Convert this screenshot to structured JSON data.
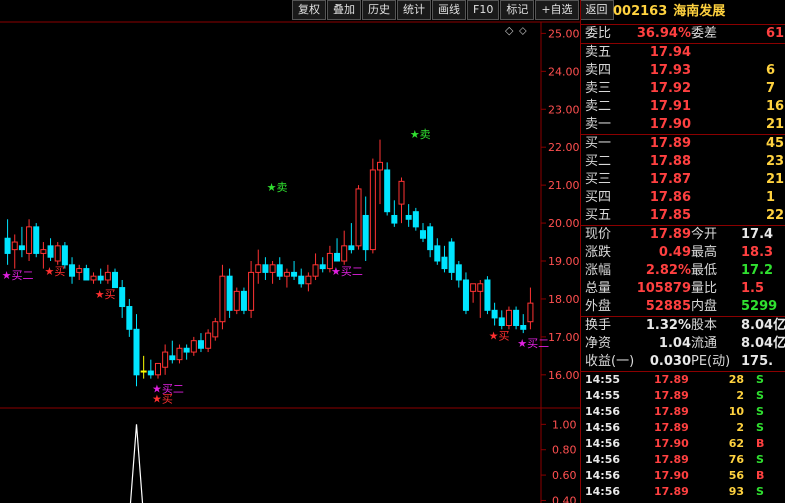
{
  "toolbar": [
    "复权",
    "叠加",
    "历史",
    "统计",
    "画线",
    "F10",
    "标记",
    "+自选",
    "返回"
  ],
  "header_icons": [
    "◇",
    "⬦"
  ],
  "stock": {
    "code": "002163",
    "name": "海南发展"
  },
  "entrust": {
    "ratio_label": "委比",
    "ratio": "36.94%",
    "diff_label": "委差",
    "diff": "61"
  },
  "asks": [
    {
      "label": "卖五",
      "price": "17.94",
      "vol": ""
    },
    {
      "label": "卖四",
      "price": "17.93",
      "vol": "6"
    },
    {
      "label": "卖三",
      "price": "17.92",
      "vol": "7"
    },
    {
      "label": "卖二",
      "price": "17.91",
      "vol": "16"
    },
    {
      "label": "卖一",
      "price": "17.90",
      "vol": "21"
    }
  ],
  "bids": [
    {
      "label": "买一",
      "price": "17.89",
      "vol": "45"
    },
    {
      "label": "买二",
      "price": "17.88",
      "vol": "23"
    },
    {
      "label": "买三",
      "price": "17.87",
      "vol": "21"
    },
    {
      "label": "买四",
      "price": "17.86",
      "vol": "1"
    },
    {
      "label": "买五",
      "price": "17.85",
      "vol": "22"
    }
  ],
  "quote": [
    {
      "l1": "现价",
      "v1": "17.89",
      "c1": "red",
      "l2": "今开",
      "v2": "17.4",
      "c2": "white"
    },
    {
      "l1": "涨跌",
      "v1": "0.49",
      "c1": "red",
      "l2": "最高",
      "v2": "18.3",
      "c2": "red"
    },
    {
      "l1": "涨幅",
      "v1": "2.82%",
      "c1": "red",
      "l2": "最低",
      "v2": "17.2",
      "c2": "green"
    },
    {
      "l1": "总量",
      "v1": "105879",
      "c1": "red",
      "l2": "量比",
      "v2": "1.5",
      "c2": "red"
    },
    {
      "l1": "外盘",
      "v1": "52885",
      "c1": "red",
      "l2": "内盘",
      "v2": "5299",
      "c2": "green"
    }
  ],
  "stats": [
    {
      "l1": "换手",
      "v1": "1.32%",
      "l2": "股本",
      "v2": "8.04亿"
    },
    {
      "l1": "净资",
      "v1": "1.04",
      "l2": "流通",
      "v2": "8.04亿"
    },
    {
      "l1": "收益(一)",
      "v1": "0.030",
      "l2": "PE(动)",
      "v2": "175."
    }
  ],
  "ticks": [
    {
      "time": "14:55",
      "price": "17.89",
      "vol": "28",
      "side": "S"
    },
    {
      "time": "14:55",
      "price": "17.89",
      "vol": "2",
      "side": "S"
    },
    {
      "time": "14:56",
      "price": "17.89",
      "vol": "10",
      "side": "S"
    },
    {
      "time": "14:56",
      "price": "17.89",
      "vol": "2",
      "side": "S"
    },
    {
      "time": "14:56",
      "price": "17.90",
      "vol": "62",
      "side": "B"
    },
    {
      "time": "14:56",
      "price": "17.89",
      "vol": "76",
      "side": "S"
    },
    {
      "time": "14:56",
      "price": "17.90",
      "vol": "56",
      "side": "B"
    },
    {
      "time": "14:56",
      "price": "17.89",
      "vol": "93",
      "side": "S"
    }
  ],
  "colors": {
    "up": "#ff3333",
    "down": "#00e5ff",
    "flat": "#ffff00",
    "buy_sig": "#ff3030",
    "buy2_sig": "#e020e0",
    "sell_sig": "#30e030",
    "axis": "#8b0000"
  },
  "chart_data": {
    "type": "candlestick",
    "price_axis": {
      "ticks": [
        "25.00",
        "24.00",
        "23.00",
        "22.00",
        "21.00",
        "20.00",
        "19.00",
        "18.00",
        "17.00",
        "16.00"
      ],
      "min": 15.6,
      "max": 25.3
    },
    "indicator_axis": {
      "ticks": [
        "1.00",
        "0.80",
        "0.60",
        "0.40"
      ],
      "min": 0.38,
      "max": 1.05
    },
    "candles": [
      {
        "o": 19.6,
        "h": 20.1,
        "l": 18.9,
        "c": 19.2
      },
      {
        "o": 19.3,
        "h": 19.7,
        "l": 18.8,
        "c": 19.5
      },
      {
        "o": 19.4,
        "h": 19.9,
        "l": 19.1,
        "c": 19.3
      },
      {
        "o": 19.2,
        "h": 20.1,
        "l": 19.0,
        "c": 19.9
      },
      {
        "o": 19.9,
        "h": 20.0,
        "l": 19.1,
        "c": 19.2
      },
      {
        "o": 19.2,
        "h": 19.5,
        "l": 18.8,
        "c": 19.3
      },
      {
        "o": 19.4,
        "h": 19.6,
        "l": 19.0,
        "c": 19.1
      },
      {
        "o": 19.0,
        "h": 19.5,
        "l": 18.9,
        "c": 19.4
      },
      {
        "o": 19.4,
        "h": 19.5,
        "l": 18.8,
        "c": 18.9
      },
      {
        "o": 18.9,
        "h": 19.1,
        "l": 18.4,
        "c": 18.6
      },
      {
        "o": 18.7,
        "h": 18.9,
        "l": 18.5,
        "c": 18.8
      },
      {
        "o": 18.8,
        "h": 18.9,
        "l": 18.5,
        "c": 18.5
      },
      {
        "o": 18.5,
        "h": 18.7,
        "l": 18.4,
        "c": 18.6
      },
      {
        "o": 18.6,
        "h": 18.8,
        "l": 18.4,
        "c": 18.5
      },
      {
        "o": 18.5,
        "h": 18.9,
        "l": 18.4,
        "c": 18.7
      },
      {
        "o": 18.7,
        "h": 18.8,
        "l": 18.3,
        "c": 18.3
      },
      {
        "o": 18.3,
        "h": 18.5,
        "l": 17.5,
        "c": 17.8
      },
      {
        "o": 17.8,
        "h": 18.0,
        "l": 17.0,
        "c": 17.2
      },
      {
        "o": 17.2,
        "h": 17.6,
        "l": 15.7,
        "c": 16.0
      },
      {
        "o": 16.1,
        "h": 16.5,
        "l": 15.9,
        "c": 16.1
      },
      {
        "o": 16.1,
        "h": 16.4,
        "l": 15.9,
        "c": 16.0
      },
      {
        "o": 16.0,
        "h": 16.3,
        "l": 15.9,
        "c": 16.3
      },
      {
        "o": 16.2,
        "h": 16.8,
        "l": 16.0,
        "c": 16.6
      },
      {
        "o": 16.5,
        "h": 16.9,
        "l": 16.3,
        "c": 16.4
      },
      {
        "o": 16.4,
        "h": 16.8,
        "l": 16.3,
        "c": 16.7
      },
      {
        "o": 16.7,
        "h": 16.8,
        "l": 16.4,
        "c": 16.6
      },
      {
        "o": 16.6,
        "h": 17.0,
        "l": 16.5,
        "c": 16.9
      },
      {
        "o": 16.9,
        "h": 17.1,
        "l": 16.6,
        "c": 16.7
      },
      {
        "o": 16.7,
        "h": 17.2,
        "l": 16.6,
        "c": 17.1
      },
      {
        "o": 17.0,
        "h": 17.5,
        "l": 16.9,
        "c": 17.4
      },
      {
        "o": 17.4,
        "h": 18.9,
        "l": 17.2,
        "c": 18.6
      },
      {
        "o": 18.6,
        "h": 18.8,
        "l": 17.5,
        "c": 17.7
      },
      {
        "o": 17.7,
        "h": 18.3,
        "l": 17.6,
        "c": 18.2
      },
      {
        "o": 18.2,
        "h": 18.3,
        "l": 17.6,
        "c": 17.7
      },
      {
        "o": 17.7,
        "h": 19.0,
        "l": 17.5,
        "c": 18.7
      },
      {
        "o": 18.7,
        "h": 19.3,
        "l": 18.4,
        "c": 18.9
      },
      {
        "o": 18.9,
        "h": 19.1,
        "l": 18.5,
        "c": 18.7
      },
      {
        "o": 18.7,
        "h": 19.0,
        "l": 18.4,
        "c": 18.9
      },
      {
        "o": 18.9,
        "h": 19.1,
        "l": 18.5,
        "c": 18.6
      },
      {
        "o": 18.6,
        "h": 18.8,
        "l": 18.3,
        "c": 18.7
      },
      {
        "o": 18.7,
        "h": 19.0,
        "l": 18.5,
        "c": 18.6
      },
      {
        "o": 18.6,
        "h": 18.8,
        "l": 18.3,
        "c": 18.4
      },
      {
        "o": 18.4,
        "h": 18.7,
        "l": 18.2,
        "c": 18.6
      },
      {
        "o": 18.6,
        "h": 19.2,
        "l": 18.5,
        "c": 18.9
      },
      {
        "o": 18.9,
        "h": 19.1,
        "l": 18.7,
        "c": 18.8
      },
      {
        "o": 18.8,
        "h": 19.4,
        "l": 18.7,
        "c": 19.2
      },
      {
        "o": 19.2,
        "h": 19.6,
        "l": 19.0,
        "c": 19.0
      },
      {
        "o": 19.0,
        "h": 19.8,
        "l": 18.9,
        "c": 19.4
      },
      {
        "o": 19.4,
        "h": 20.0,
        "l": 19.2,
        "c": 19.3
      },
      {
        "o": 19.4,
        "h": 21.0,
        "l": 19.3,
        "c": 20.9
      },
      {
        "o": 20.2,
        "h": 20.7,
        "l": 19.0,
        "c": 19.3
      },
      {
        "o": 19.3,
        "h": 21.7,
        "l": 19.2,
        "c": 21.4
      },
      {
        "o": 21.4,
        "h": 22.2,
        "l": 20.5,
        "c": 21.6
      },
      {
        "o": 21.4,
        "h": 21.6,
        "l": 20.2,
        "c": 20.3
      },
      {
        "o": 20.2,
        "h": 20.6,
        "l": 19.9,
        "c": 20.0
      },
      {
        "o": 20.5,
        "h": 21.2,
        "l": 20.0,
        "c": 21.1
      },
      {
        "o": 20.2,
        "h": 20.5,
        "l": 19.9,
        "c": 20.1
      },
      {
        "o": 20.3,
        "h": 20.4,
        "l": 19.8,
        "c": 19.9
      },
      {
        "o": 19.8,
        "h": 20.0,
        "l": 19.5,
        "c": 19.6
      },
      {
        "o": 19.9,
        "h": 20.0,
        "l": 19.1,
        "c": 19.3
      },
      {
        "o": 19.4,
        "h": 19.6,
        "l": 18.9,
        "c": 19.0
      },
      {
        "o": 19.1,
        "h": 19.4,
        "l": 18.7,
        "c": 18.8
      },
      {
        "o": 19.5,
        "h": 19.6,
        "l": 18.5,
        "c": 18.7
      },
      {
        "o": 18.9,
        "h": 19.0,
        "l": 18.3,
        "c": 18.5
      },
      {
        "o": 18.5,
        "h": 18.7,
        "l": 17.6,
        "c": 17.7
      },
      {
        "o": 18.2,
        "h": 18.4,
        "l": 17.9,
        "c": 18.4
      },
      {
        "o": 18.2,
        "h": 18.5,
        "l": 17.5,
        "c": 18.4
      },
      {
        "o": 18.5,
        "h": 18.6,
        "l": 17.6,
        "c": 17.7
      },
      {
        "o": 17.7,
        "h": 17.9,
        "l": 17.3,
        "c": 17.5
      },
      {
        "o": 17.5,
        "h": 17.7,
        "l": 17.2,
        "c": 17.3
      },
      {
        "o": 17.3,
        "h": 17.8,
        "l": 17.2,
        "c": 17.7
      },
      {
        "o": 17.7,
        "h": 17.8,
        "l": 17.2,
        "c": 17.3
      },
      {
        "o": 17.3,
        "h": 17.6,
        "l": 17.1,
        "c": 17.2
      },
      {
        "o": 17.4,
        "h": 18.3,
        "l": 17.2,
        "c": 17.89
      }
    ],
    "signals": [
      {
        "index": 0,
        "label": "★买二",
        "kind": "buy2",
        "pos": "below"
      },
      {
        "index": 6,
        "label": "★买",
        "kind": "buy",
        "pos": "below"
      },
      {
        "index": 13,
        "label": "★买",
        "kind": "buy",
        "pos": "below"
      },
      {
        "index": 21,
        "label": "★买二",
        "kind": "buy2",
        "pos": "below"
      },
      {
        "index": 21,
        "label": "★买",
        "kind": "buy",
        "pos": "below"
      },
      {
        "index": 37,
        "label": "★卖",
        "kind": "sell",
        "pos": "above"
      },
      {
        "index": 46,
        "label": "★买二",
        "kind": "buy2",
        "pos": "below"
      },
      {
        "index": 57,
        "label": "★卖",
        "kind": "sell",
        "pos": "above"
      },
      {
        "index": 68,
        "label": "★买",
        "kind": "buy",
        "pos": "below"
      },
      {
        "index": 72,
        "label": "★买二",
        "kind": "buy2",
        "pos": "below"
      }
    ],
    "indicator": {
      "spike_index": 18,
      "peak": 1.0,
      "base": 0.38
    }
  }
}
